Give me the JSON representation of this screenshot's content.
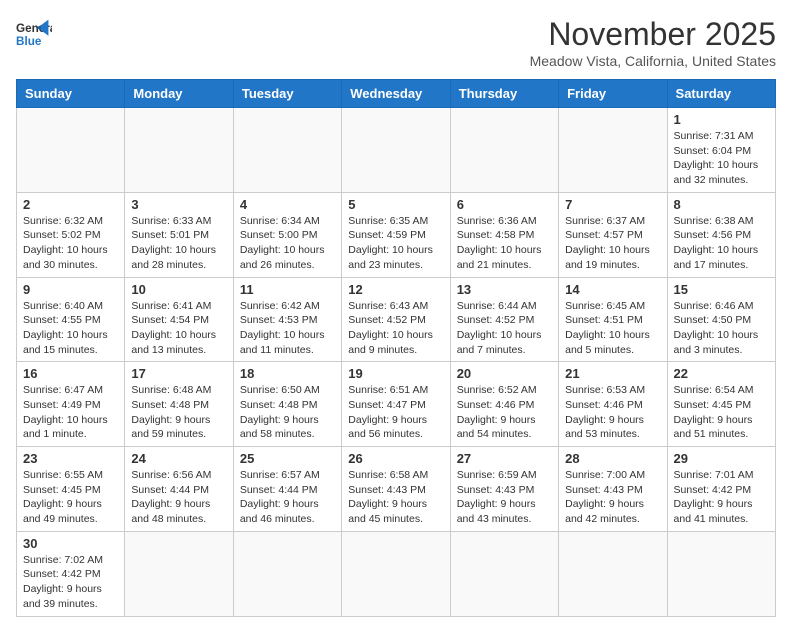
{
  "logo": {
    "line1": "General",
    "line2": "Blue"
  },
  "header": {
    "title": "November 2025",
    "subtitle": "Meadow Vista, California, United States"
  },
  "weekdays": [
    "Sunday",
    "Monday",
    "Tuesday",
    "Wednesday",
    "Thursday",
    "Friday",
    "Saturday"
  ],
  "weeks": [
    [
      {
        "day": "",
        "info": ""
      },
      {
        "day": "",
        "info": ""
      },
      {
        "day": "",
        "info": ""
      },
      {
        "day": "",
        "info": ""
      },
      {
        "day": "",
        "info": ""
      },
      {
        "day": "",
        "info": ""
      },
      {
        "day": "1",
        "info": "Sunrise: 7:31 AM\nSunset: 6:04 PM\nDaylight: 10 hours\nand 32 minutes."
      }
    ],
    [
      {
        "day": "2",
        "info": "Sunrise: 6:32 AM\nSunset: 5:02 PM\nDaylight: 10 hours\nand 30 minutes."
      },
      {
        "day": "3",
        "info": "Sunrise: 6:33 AM\nSunset: 5:01 PM\nDaylight: 10 hours\nand 28 minutes."
      },
      {
        "day": "4",
        "info": "Sunrise: 6:34 AM\nSunset: 5:00 PM\nDaylight: 10 hours\nand 26 minutes."
      },
      {
        "day": "5",
        "info": "Sunrise: 6:35 AM\nSunset: 4:59 PM\nDaylight: 10 hours\nand 23 minutes."
      },
      {
        "day": "6",
        "info": "Sunrise: 6:36 AM\nSunset: 4:58 PM\nDaylight: 10 hours\nand 21 minutes."
      },
      {
        "day": "7",
        "info": "Sunrise: 6:37 AM\nSunset: 4:57 PM\nDaylight: 10 hours\nand 19 minutes."
      },
      {
        "day": "8",
        "info": "Sunrise: 6:38 AM\nSunset: 4:56 PM\nDaylight: 10 hours\nand 17 minutes."
      }
    ],
    [
      {
        "day": "9",
        "info": "Sunrise: 6:40 AM\nSunset: 4:55 PM\nDaylight: 10 hours\nand 15 minutes."
      },
      {
        "day": "10",
        "info": "Sunrise: 6:41 AM\nSunset: 4:54 PM\nDaylight: 10 hours\nand 13 minutes."
      },
      {
        "day": "11",
        "info": "Sunrise: 6:42 AM\nSunset: 4:53 PM\nDaylight: 10 hours\nand 11 minutes."
      },
      {
        "day": "12",
        "info": "Sunrise: 6:43 AM\nSunset: 4:52 PM\nDaylight: 10 hours\nand 9 minutes."
      },
      {
        "day": "13",
        "info": "Sunrise: 6:44 AM\nSunset: 4:52 PM\nDaylight: 10 hours\nand 7 minutes."
      },
      {
        "day": "14",
        "info": "Sunrise: 6:45 AM\nSunset: 4:51 PM\nDaylight: 10 hours\nand 5 minutes."
      },
      {
        "day": "15",
        "info": "Sunrise: 6:46 AM\nSunset: 4:50 PM\nDaylight: 10 hours\nand 3 minutes."
      }
    ],
    [
      {
        "day": "16",
        "info": "Sunrise: 6:47 AM\nSunset: 4:49 PM\nDaylight: 10 hours\nand 1 minute."
      },
      {
        "day": "17",
        "info": "Sunrise: 6:48 AM\nSunset: 4:48 PM\nDaylight: 9 hours\nand 59 minutes."
      },
      {
        "day": "18",
        "info": "Sunrise: 6:50 AM\nSunset: 4:48 PM\nDaylight: 9 hours\nand 58 minutes."
      },
      {
        "day": "19",
        "info": "Sunrise: 6:51 AM\nSunset: 4:47 PM\nDaylight: 9 hours\nand 56 minutes."
      },
      {
        "day": "20",
        "info": "Sunrise: 6:52 AM\nSunset: 4:46 PM\nDaylight: 9 hours\nand 54 minutes."
      },
      {
        "day": "21",
        "info": "Sunrise: 6:53 AM\nSunset: 4:46 PM\nDaylight: 9 hours\nand 53 minutes."
      },
      {
        "day": "22",
        "info": "Sunrise: 6:54 AM\nSunset: 4:45 PM\nDaylight: 9 hours\nand 51 minutes."
      }
    ],
    [
      {
        "day": "23",
        "info": "Sunrise: 6:55 AM\nSunset: 4:45 PM\nDaylight: 9 hours\nand 49 minutes."
      },
      {
        "day": "24",
        "info": "Sunrise: 6:56 AM\nSunset: 4:44 PM\nDaylight: 9 hours\nand 48 minutes."
      },
      {
        "day": "25",
        "info": "Sunrise: 6:57 AM\nSunset: 4:44 PM\nDaylight: 9 hours\nand 46 minutes."
      },
      {
        "day": "26",
        "info": "Sunrise: 6:58 AM\nSunset: 4:43 PM\nDaylight: 9 hours\nand 45 minutes."
      },
      {
        "day": "27",
        "info": "Sunrise: 6:59 AM\nSunset: 4:43 PM\nDaylight: 9 hours\nand 43 minutes."
      },
      {
        "day": "28",
        "info": "Sunrise: 7:00 AM\nSunset: 4:43 PM\nDaylight: 9 hours\nand 42 minutes."
      },
      {
        "day": "29",
        "info": "Sunrise: 7:01 AM\nSunset: 4:42 PM\nDaylight: 9 hours\nand 41 minutes."
      }
    ],
    [
      {
        "day": "30",
        "info": "Sunrise: 7:02 AM\nSunset: 4:42 PM\nDaylight: 9 hours\nand 39 minutes."
      },
      {
        "day": "",
        "info": ""
      },
      {
        "day": "",
        "info": ""
      },
      {
        "day": "",
        "info": ""
      },
      {
        "day": "",
        "info": ""
      },
      {
        "day": "",
        "info": ""
      },
      {
        "day": "",
        "info": ""
      }
    ]
  ]
}
